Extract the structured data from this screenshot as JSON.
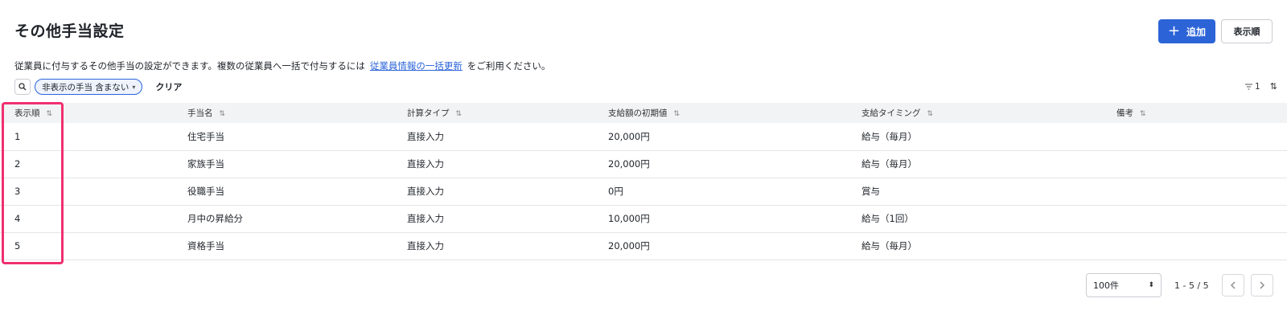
{
  "page": {
    "title": "その他手当設定",
    "description_before": "従業員に付与するその他手当の設定ができます。複数の従業員へ一括で付与するには",
    "description_link": "従業員情報の一括更新",
    "description_after": "をご利用ください。"
  },
  "toolbar": {
    "add_label": "追加",
    "order_label": "表示順"
  },
  "filter": {
    "chip_label": "非表示の手当 含まない",
    "clear_label": "クリア",
    "filter_count": "1"
  },
  "table": {
    "columns": [
      "表示順",
      "手当名",
      "計算タイプ",
      "支給額の初期値",
      "支給タイミング",
      "備考"
    ],
    "rows": [
      [
        "1",
        "住宅手当",
        "直接入力",
        "20,000円",
        "給与（毎月）",
        ""
      ],
      [
        "2",
        "家族手当",
        "直接入力",
        "20,000円",
        "給与（毎月）",
        ""
      ],
      [
        "3",
        "役職手当",
        "直接入力",
        "0円",
        "賞与",
        ""
      ],
      [
        "4",
        "月中の昇給分",
        "直接入力",
        "10,000円",
        "給与（1回）",
        ""
      ],
      [
        "5",
        "資格手当",
        "直接入力",
        "20,000円",
        "給与（毎月）",
        ""
      ]
    ]
  },
  "pagination": {
    "per_page": "100件",
    "range": "1 - 5 / 5"
  },
  "colors": {
    "primary": "#2c64d8",
    "highlight": "#f0306f"
  }
}
